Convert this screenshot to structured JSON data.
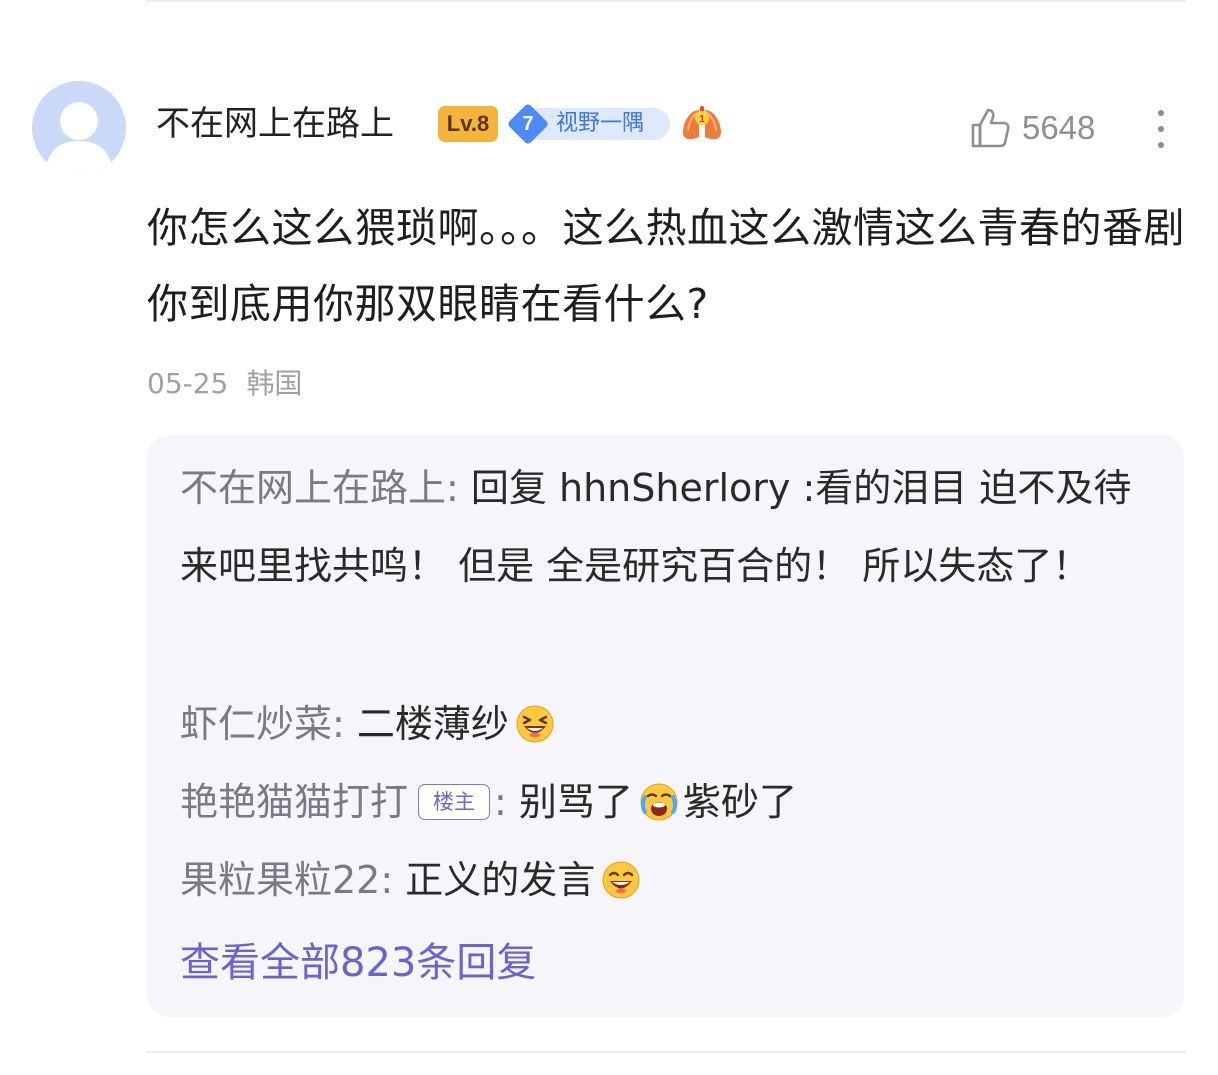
{
  "comment": {
    "username": "不在网上在路上",
    "level_badge": "Lv.8",
    "fan_badge": {
      "level": "7",
      "name": "视野一隅"
    },
    "extra_badge_icon": "lungs-icon",
    "like_count": "5648",
    "text": "你怎么这么猥琐啊。。。这么热血这么激情这么青春的番剧 你到底用你那双眼睛在看什么?",
    "date": "05-25",
    "location": "韩国"
  },
  "replies": [
    {
      "name": "不在网上在路上",
      "colon": ":",
      "text": "回复 hhnSherlory :看的泪目 迫不及待来吧里找共鸣！ 但是 全是研究百合的！ 所以失态了！"
    },
    {
      "name": "虾仁炒菜",
      "colon": ":",
      "text": "二楼薄纱",
      "emoji": "grinning-squint-emoji"
    },
    {
      "name": "艳艳猫猫打打",
      "host_tag": "楼主",
      "colon": ":",
      "text_before": "别骂了",
      "emoji": "crying-laughing-emoji",
      "text_after": "紫砂了"
    },
    {
      "name": "果粒果粒22",
      "colon": ":",
      "text": "正义的发言",
      "emoji": "laughing-emoji"
    }
  ],
  "view_all": "查看全部823条回复",
  "colors": {
    "accent": "#6a63d0",
    "level_badge": "#f4b33b",
    "fan_badge": "#4e8af5",
    "reply_bg": "#f5f5fa"
  }
}
